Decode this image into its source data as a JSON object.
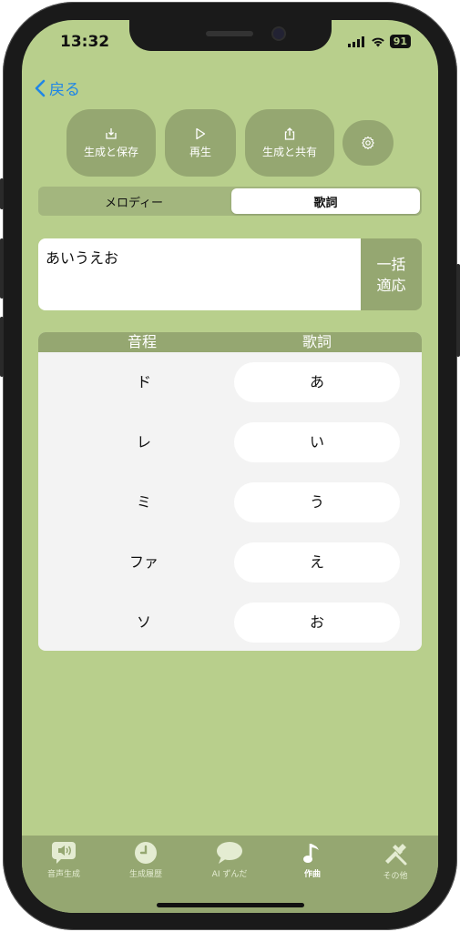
{
  "status": {
    "time": "13:32",
    "battery": "91"
  },
  "nav": {
    "back_label": "戻る"
  },
  "actions": {
    "generate_save": "生成と保存",
    "play": "再生",
    "generate_share": "生成と共有"
  },
  "segment": {
    "melody": "メロディー",
    "lyrics": "歌詞",
    "selected": "歌詞"
  },
  "lyric_input": {
    "value": "あいうえお"
  },
  "apply_button": {
    "line1": "一括",
    "line2": "適応"
  },
  "table": {
    "headers": {
      "pitch": "音程",
      "lyric": "歌詞"
    },
    "rows": [
      {
        "pitch": "ド",
        "lyric": "あ"
      },
      {
        "pitch": "レ",
        "lyric": "い"
      },
      {
        "pitch": "ミ",
        "lyric": "う"
      },
      {
        "pitch": "ファ",
        "lyric": "え"
      },
      {
        "pitch": "ソ",
        "lyric": "お"
      }
    ]
  },
  "tabs": [
    {
      "label": "音声生成",
      "icon": "speaker-bubble-icon"
    },
    {
      "label": "生成履歴",
      "icon": "clock-icon"
    },
    {
      "label": "AI ずんだ",
      "icon": "chat-bubble-icon"
    },
    {
      "label": "作曲",
      "icon": "music-note-icon",
      "active": true
    },
    {
      "label": "その他",
      "icon": "tools-icon"
    }
  ],
  "colors": {
    "background": "#b8cf8c",
    "accent": "#95a771",
    "link": "#1f86e6"
  }
}
